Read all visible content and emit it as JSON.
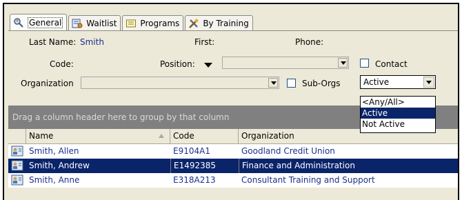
{
  "tabs": [
    {
      "label": "General",
      "icon": "search-person-icon",
      "active": true
    },
    {
      "label": "Waitlist",
      "icon": "waitlist-icon",
      "active": false
    },
    {
      "label": "Programs",
      "icon": "programs-icon",
      "active": false
    },
    {
      "label": "By Training",
      "icon": "training-tools-icon",
      "active": false
    }
  ],
  "filters": {
    "last_name_label": "Last Name:",
    "last_name_value": "Smith",
    "first_label": "First:",
    "phone_label": "Phone:",
    "code_label": "Code:",
    "position_label": "Position:",
    "contact_label": "Contact",
    "organization_label": "Organization",
    "suborgs_label": "Sub-Orgs",
    "status_value": "Active",
    "status_options": [
      "<Any/All>",
      "Active",
      "Not Active"
    ],
    "status_selected_index": 1
  },
  "group_hint": "Drag a column header here to group by that column",
  "grid": {
    "columns": [
      "Name",
      "Code",
      "Organization"
    ],
    "rows": [
      {
        "name": "Smith, Allen",
        "code": "E9104A1",
        "organization": "Goodland Credit Union",
        "selected": false
      },
      {
        "name": "Smith, Andrew",
        "code": "E1492385",
        "organization": "Finance and Administration",
        "selected": true
      },
      {
        "name": "Smith, Anne",
        "code": "E318A213",
        "organization": "Consultant Training and Support",
        "selected": false
      }
    ]
  },
  "colors": {
    "value_text": "#1c2f8c",
    "selection": "#0a246a",
    "panel": "#ece9d8",
    "group_bar": "#808080"
  }
}
